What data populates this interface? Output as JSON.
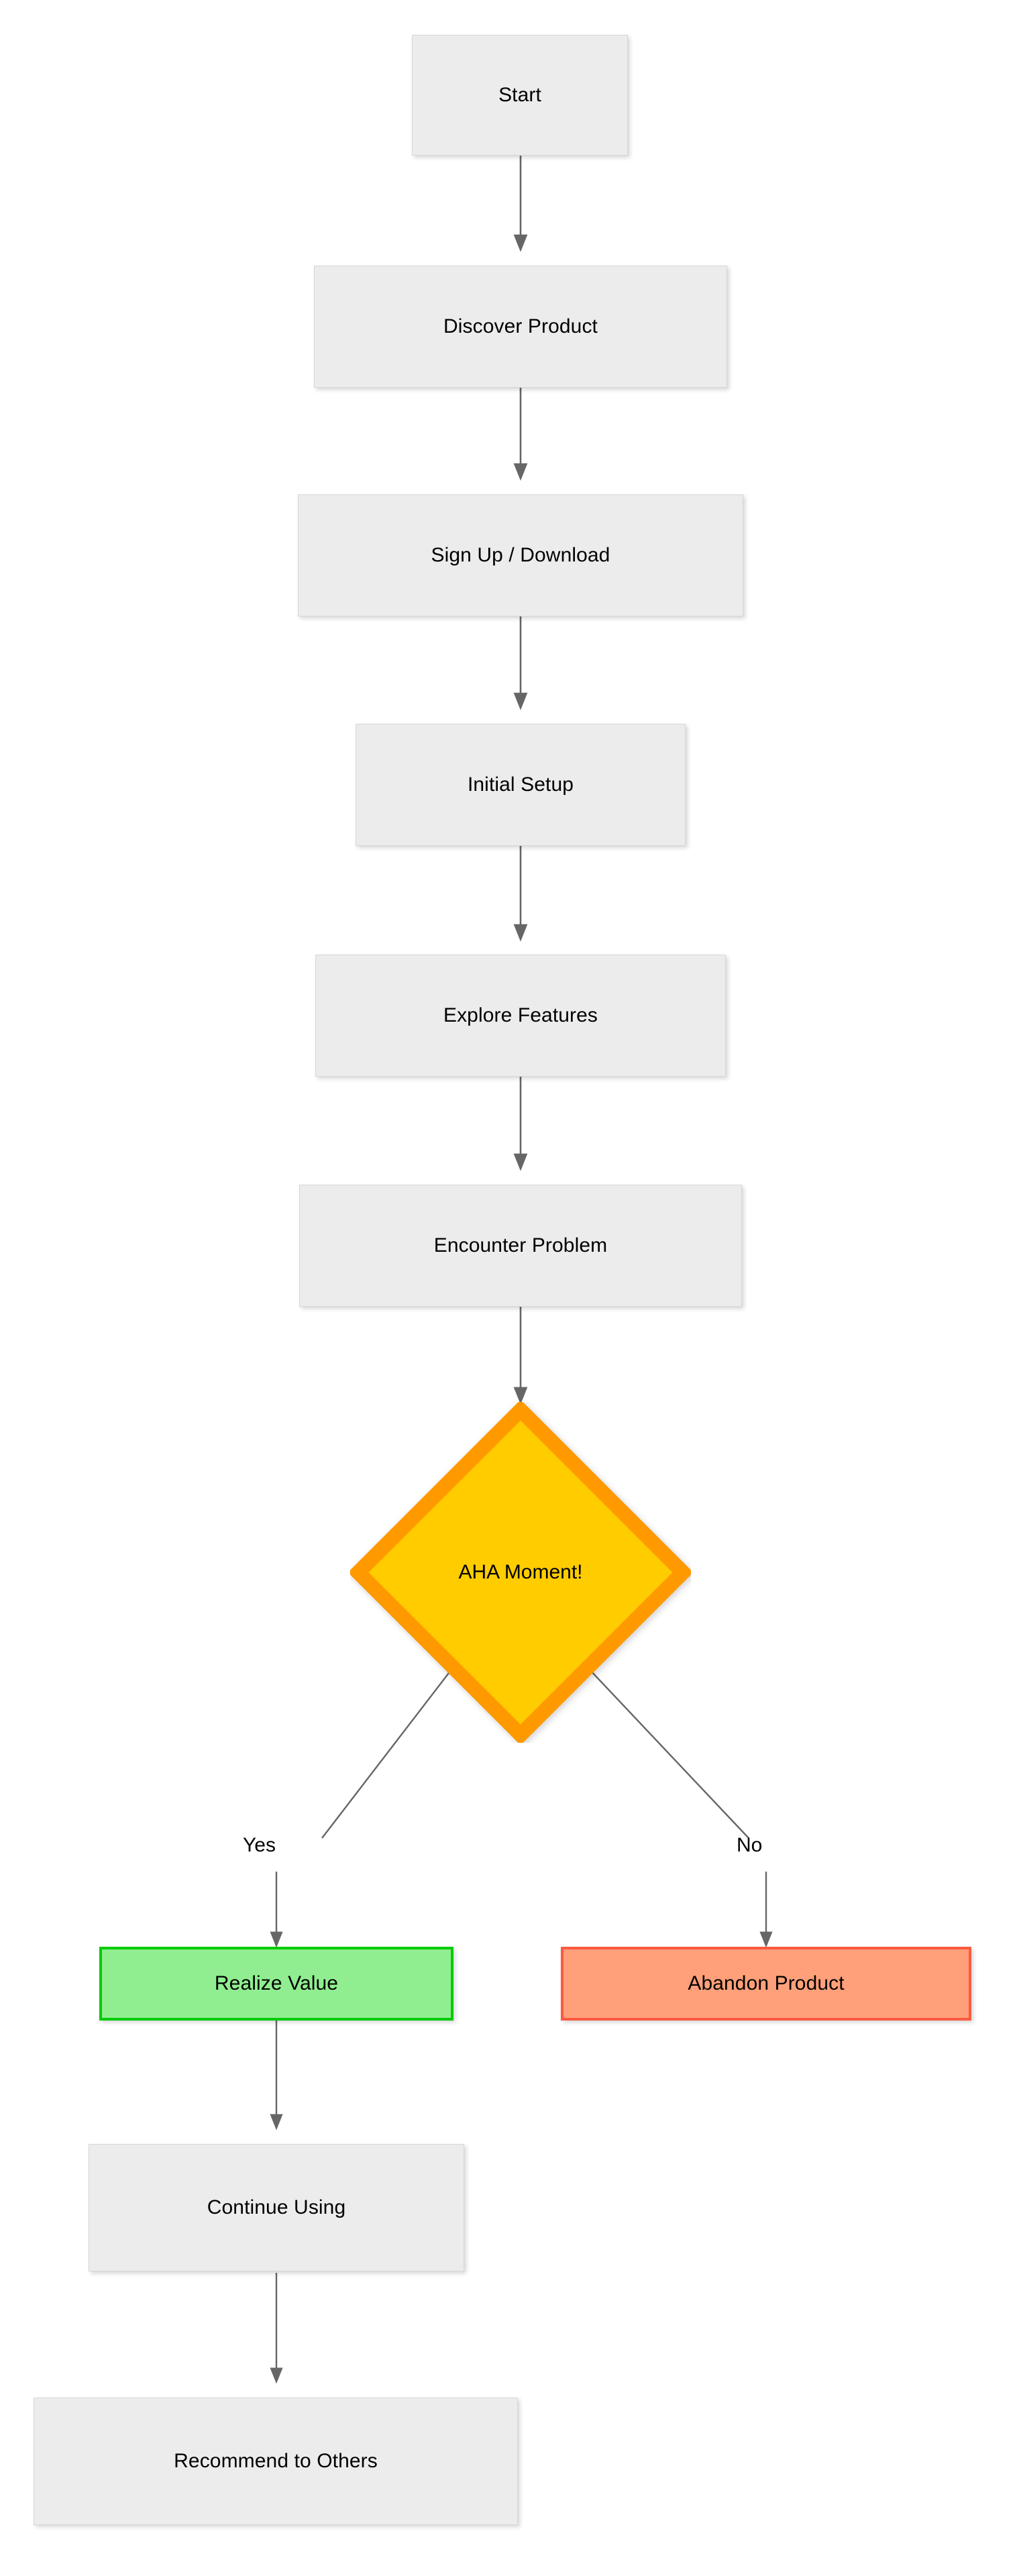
{
  "diagram": {
    "type": "flowchart",
    "orientation": "top-to-bottom",
    "background_color": "#ffffff",
    "edge_color": "#666666",
    "nodes": [
      {
        "id": "start",
        "label": "Start",
        "shape": "rectangle",
        "style": "default",
        "fill": "#ececec",
        "border": "#d7d7d7"
      },
      {
        "id": "discover",
        "label": "Discover Product",
        "shape": "rectangle",
        "style": "default",
        "fill": "#ececec",
        "border": "#d7d7d7"
      },
      {
        "id": "signup",
        "label": "Sign Up / Download",
        "shape": "rectangle",
        "style": "default",
        "fill": "#ececec",
        "border": "#d7d7d7"
      },
      {
        "id": "setup",
        "label": "Initial Setup",
        "shape": "rectangle",
        "style": "default",
        "fill": "#ececec",
        "border": "#d7d7d7"
      },
      {
        "id": "explore",
        "label": "Explore Features",
        "shape": "rectangle",
        "style": "default",
        "fill": "#ececec",
        "border": "#d7d7d7"
      },
      {
        "id": "problem",
        "label": "Encounter Problem",
        "shape": "rectangle",
        "style": "default",
        "fill": "#ececec",
        "border": "#d7d7d7"
      },
      {
        "id": "aha",
        "label": "AHA Moment!",
        "shape": "diamond",
        "style": "decision",
        "fill": "#ffcc00",
        "border": "#ff9900"
      },
      {
        "id": "realize",
        "label": "Realize Value",
        "shape": "rectangle",
        "style": "success",
        "fill": "#90ee90",
        "border": "#00cc00"
      },
      {
        "id": "abandon",
        "label": "Abandon Product",
        "shape": "rectangle",
        "style": "failure",
        "fill": "#ffa07a",
        "border": "#fb5a40"
      },
      {
        "id": "continue",
        "label": "Continue Using",
        "shape": "rectangle",
        "style": "default",
        "fill": "#ececec",
        "border": "#d7d7d7"
      },
      {
        "id": "recommend",
        "label": "Recommend to Others",
        "shape": "rectangle",
        "style": "default",
        "fill": "#ececec",
        "border": "#d7d7d7"
      }
    ],
    "edges": [
      {
        "from": "start",
        "to": "discover",
        "label": ""
      },
      {
        "from": "discover",
        "to": "signup",
        "label": ""
      },
      {
        "from": "signup",
        "to": "setup",
        "label": ""
      },
      {
        "from": "setup",
        "to": "explore",
        "label": ""
      },
      {
        "from": "explore",
        "to": "problem",
        "label": ""
      },
      {
        "from": "problem",
        "to": "aha",
        "label": ""
      },
      {
        "from": "aha",
        "to": "realize",
        "label": "Yes"
      },
      {
        "from": "aha",
        "to": "abandon",
        "label": "No"
      },
      {
        "from": "realize",
        "to": "continue",
        "label": ""
      },
      {
        "from": "continue",
        "to": "recommend",
        "label": ""
      }
    ],
    "edge_labels": {
      "yes": "Yes",
      "no": "No"
    }
  }
}
